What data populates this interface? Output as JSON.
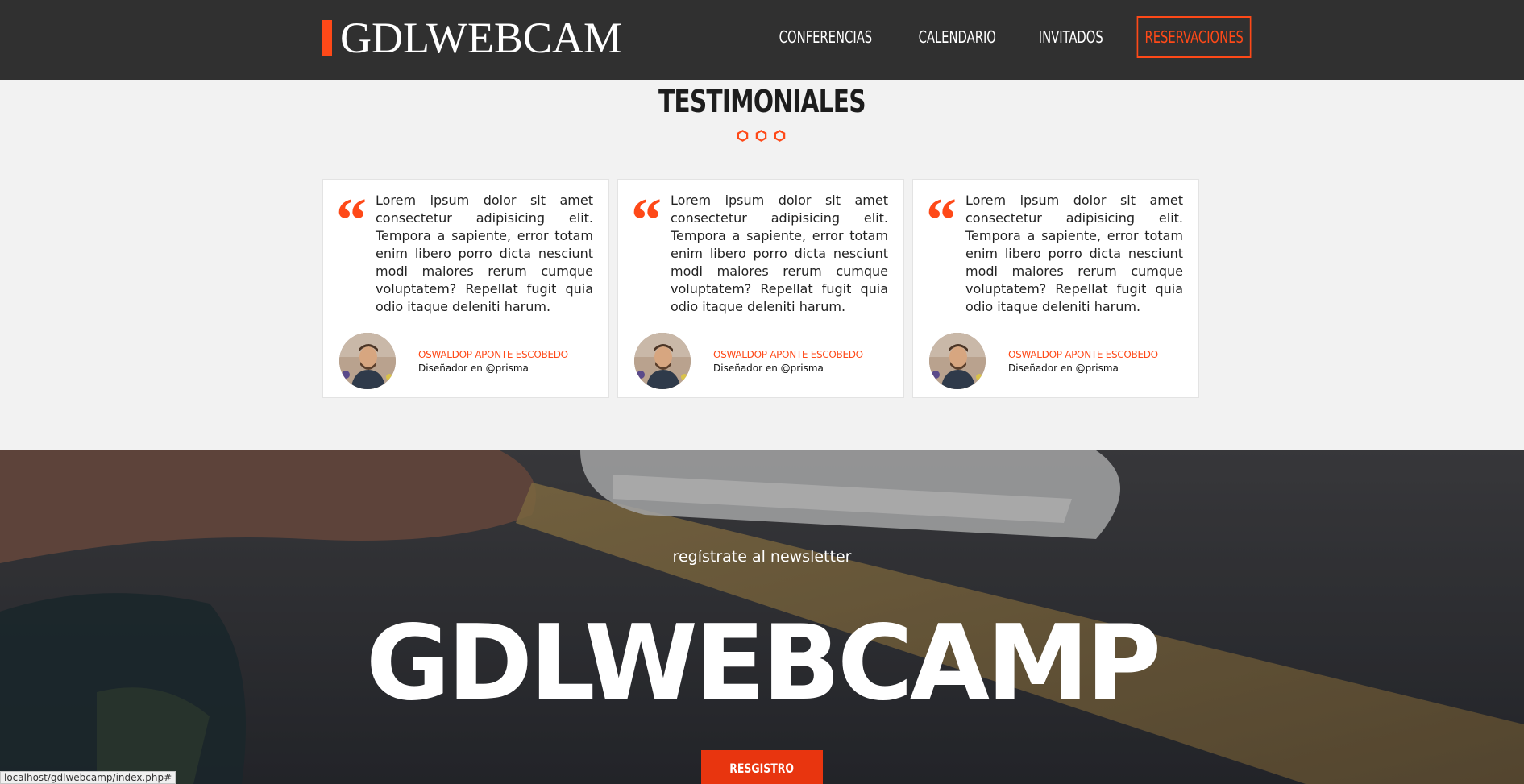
{
  "header": {
    "logo": "GDLWEBCAM",
    "nav": [
      "CONFERENCIAS",
      "CALENDARIO",
      "INVITADOS",
      "RESERVACIONES"
    ]
  },
  "testimonials": {
    "title": "TESTIMONIALES",
    "cards": [
      {
        "quote": "Lorem ipsum dolor sit amet consectetur adipisicing elit. Tempora a sapiente, error totam enim libero porro dicta nesciunt modi maiores rerum cumque voluptatem? Repellat fugit quia odio itaque deleniti harum.",
        "name": "OSWALDOP APONTE ESCOBEDO",
        "role": "Diseñador en @prisma"
      },
      {
        "quote": "Lorem ipsum dolor sit amet consectetur adipisicing elit. Tempora a sapiente, error totam enim libero porro dicta nesciunt modi maiores rerum cumque voluptatem? Repellat fugit quia odio itaque deleniti harum.",
        "name": "OSWALDOP APONTE ESCOBEDO",
        "role": "Diseñador en @prisma"
      },
      {
        "quote": "Lorem ipsum dolor sit amet consectetur adipisicing elit. Tempora a sapiente, error totam enim libero porro dicta nesciunt modi maiores rerum cumque voluptatem? Repellat fugit quia odio itaque deleniti harum.",
        "name": "OSWALDOP APONTE ESCOBEDO",
        "role": "Diseñador en @prisma"
      }
    ]
  },
  "newsletter": {
    "subtitle": "regístrate al newsletter",
    "title": "GDLWEBCAMP",
    "button": "RESGISTRO"
  },
  "status_bar": "localhost/gdlwebcamp/index.php#",
  "colors": {
    "accent": "#fe4918",
    "header_bg": "#303030",
    "section_bg": "#f2f2f2"
  }
}
